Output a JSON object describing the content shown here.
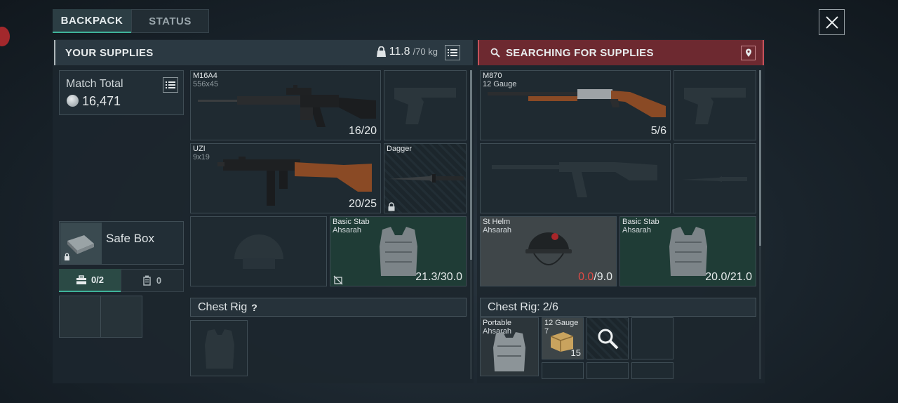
{
  "tabs": [
    {
      "label": "BACKPACK",
      "active": true
    },
    {
      "label": "STATUS",
      "active": false
    }
  ],
  "left_panel": {
    "title": "YOUR SUPPLIES",
    "weight_current": "11.8",
    "weight_max": "/70 kg",
    "match_total": {
      "label": "Match Total",
      "value": "16,471"
    },
    "safe_box": {
      "label": "Safe Box",
      "tab_items": "0/2",
      "tab_other": "0"
    },
    "items": {
      "primary": {
        "name": "M16A4",
        "ammo": "556x45",
        "count": "16/20",
        "icon": "rifle-icon"
      },
      "pistol": {
        "icon": "pistol-icon"
      },
      "secondary": {
        "name": "UZI",
        "ammo": "9x19",
        "count": "20/25",
        "icon": "smg-icon"
      },
      "melee": {
        "name": "Dagger",
        "icon": "dagger-icon"
      },
      "helmet": {
        "icon": "helmet-icon"
      },
      "armor": {
        "name": "Basic Stab",
        "sub": "Ahsarah",
        "count": "21.3/30.0",
        "icon": "vest-icon"
      }
    },
    "chest_rig": {
      "label": "Chest Rig",
      "help": "?"
    }
  },
  "right_panel": {
    "title": "SEARCHING FOR SUPPLIES",
    "items": {
      "primary": {
        "name": "M870",
        "ammo": "12 Gauge",
        "count": "5/6",
        "icon": "shotgun-icon"
      },
      "pistol": {
        "icon": "pistol-icon"
      },
      "secondary": {
        "icon": "rifle-icon"
      },
      "melee": {
        "icon": "knife-icon"
      },
      "helmet": {
        "name": "St Helm",
        "sub": "Ahsarah",
        "count_red": "0.0",
        "count_max": "/9.0",
        "icon": "helmet-icon"
      },
      "armor": {
        "name": "Basic Stab",
        "sub": "Ahsarah",
        "count": "20.0/21.0",
        "icon": "vest-icon"
      }
    },
    "chest_rig": {
      "label": "Chest Rig:",
      "value": "2/6"
    },
    "rig_items": [
      {
        "name": "Portable",
        "sub": "Ahsarah",
        "icon": "vest-icon"
      },
      {
        "name": "12 Gauge",
        "sub": "7",
        "count": "15",
        "icon": "ammo-box-icon"
      },
      {
        "icon": "search-icon"
      }
    ]
  },
  "colors": {
    "accent": "#3fb39a",
    "search_header": "#6d2930",
    "armor_slot": "#1f3c36",
    "durability_zero": "#e04a45"
  }
}
